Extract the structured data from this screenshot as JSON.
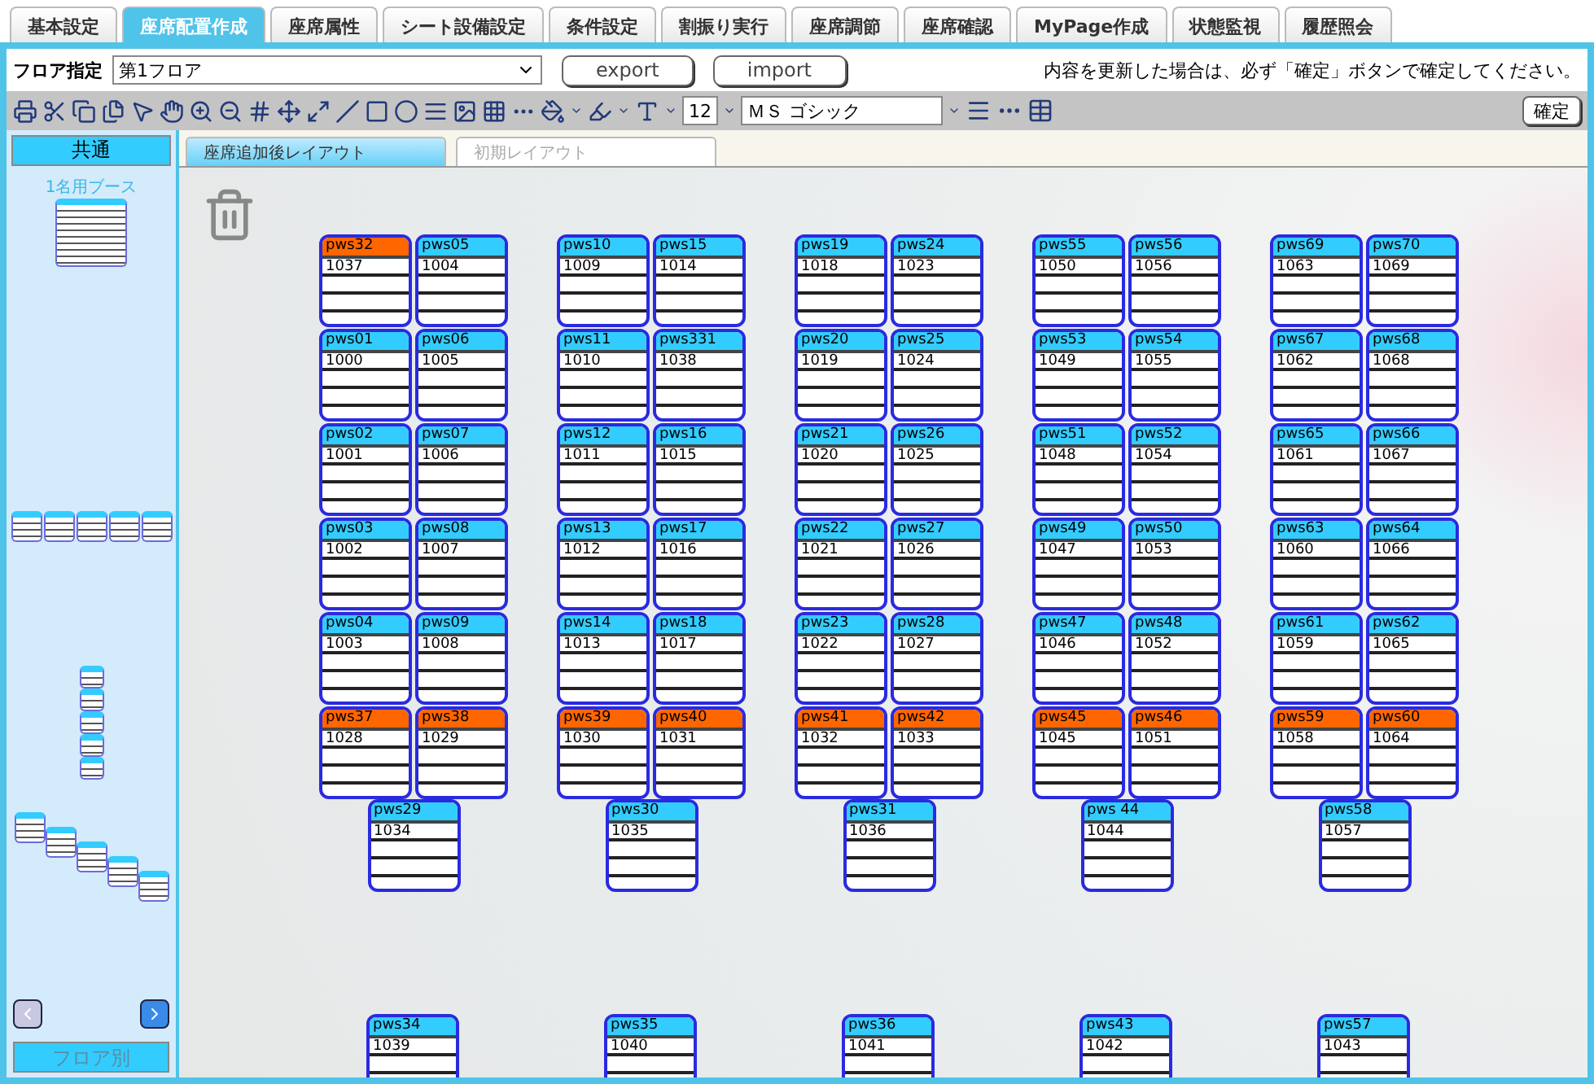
{
  "tabs": [
    {
      "label": "基本設定",
      "selected": false
    },
    {
      "label": "座席配置作成",
      "selected": true
    },
    {
      "label": "座席属性",
      "selected": false
    },
    {
      "label": "シート設備設定",
      "selected": false
    },
    {
      "label": "条件設定",
      "selected": false
    },
    {
      "label": "割振り実行",
      "selected": false
    },
    {
      "label": "座席調節",
      "selected": false
    },
    {
      "label": "座席確認",
      "selected": false
    },
    {
      "label": "MyPage作成",
      "selected": false
    },
    {
      "label": "状態監視",
      "selected": false
    },
    {
      "label": "履歴照会",
      "selected": false
    }
  ],
  "header": {
    "floor_label": "フロア指定",
    "floor_value": "第1フロア",
    "buttons": [
      "export",
      "import"
    ],
    "notice": "内容を更新した場合は、必ず「確定」ボタンで確定してください。"
  },
  "toolbar": {
    "font_size": "12",
    "font_name": "ＭＳ ゴシック",
    "confirm": "確定"
  },
  "sidebar": {
    "header": "共通",
    "booth_label": "1名用ブース",
    "footer": "フロア別"
  },
  "layout_tabs": [
    {
      "label": "座席追加後レイアウト",
      "selected": true
    },
    {
      "label": "初期レイアウト",
      "selected": false
    }
  ],
  "groups": [
    {
      "desks": [
        {
          "name": "pws32",
          "number": "1037",
          "highlighted": true
        },
        {
          "name": "pws05",
          "number": "1004",
          "highlighted": false
        },
        {
          "name": "pws01",
          "number": "1000",
          "highlighted": false
        },
        {
          "name": "pws06",
          "number": "1005",
          "highlighted": false
        },
        {
          "name": "pws02",
          "number": "1001",
          "highlighted": false
        },
        {
          "name": "pws07",
          "number": "1006",
          "highlighted": false
        },
        {
          "name": "pws03",
          "number": "1002",
          "highlighted": false
        },
        {
          "name": "pws08",
          "number": "1007",
          "highlighted": false
        },
        {
          "name": "pws04",
          "number": "1003",
          "highlighted": false
        },
        {
          "name": "pws09",
          "number": "1008",
          "highlighted": false
        },
        {
          "name": "pws37",
          "number": "1028",
          "highlighted": true
        },
        {
          "name": "pws38",
          "number": "1029",
          "highlighted": true
        }
      ],
      "single": {
        "name": "pws29",
        "number": "1034",
        "highlighted": false
      },
      "bottom": {
        "name": "pws34",
        "number": "1039",
        "highlighted": false
      }
    },
    {
      "desks": [
        {
          "name": "pws10",
          "number": "1009",
          "highlighted": false
        },
        {
          "name": "pws15",
          "number": "1014",
          "highlighted": false
        },
        {
          "name": "pws11",
          "number": "1010",
          "highlighted": false
        },
        {
          "name": "pws331",
          "number": "1038",
          "highlighted": false
        },
        {
          "name": "pws12",
          "number": "1011",
          "highlighted": false
        },
        {
          "name": "pws16",
          "number": "1015",
          "highlighted": false
        },
        {
          "name": "pws13",
          "number": "1012",
          "highlighted": false
        },
        {
          "name": "pws17",
          "number": "1016",
          "highlighted": false
        },
        {
          "name": "pws14",
          "number": "1013",
          "highlighted": false
        },
        {
          "name": "pws18",
          "number": "1017",
          "highlighted": false
        },
        {
          "name": "pws39",
          "number": "1030",
          "highlighted": true
        },
        {
          "name": "pws40",
          "number": "1031",
          "highlighted": true
        }
      ],
      "single": {
        "name": "pws30",
        "number": "1035",
        "highlighted": false
      },
      "bottom": {
        "name": "pws35",
        "number": "1040",
        "highlighted": false
      }
    },
    {
      "desks": [
        {
          "name": "pws19",
          "number": "1018",
          "highlighted": false
        },
        {
          "name": "pws24",
          "number": "1023",
          "highlighted": false
        },
        {
          "name": "pws20",
          "number": "1019",
          "highlighted": false
        },
        {
          "name": "pws25",
          "number": "1024",
          "highlighted": false
        },
        {
          "name": "pws21",
          "number": "1020",
          "highlighted": false
        },
        {
          "name": "pws26",
          "number": "1025",
          "highlighted": false
        },
        {
          "name": "pws22",
          "number": "1021",
          "highlighted": false
        },
        {
          "name": "pws27",
          "number": "1026",
          "highlighted": false
        },
        {
          "name": "pws23",
          "number": "1022",
          "highlighted": false
        },
        {
          "name": "pws28",
          "number": "1027",
          "highlighted": false
        },
        {
          "name": "pws41",
          "number": "1032",
          "highlighted": true
        },
        {
          "name": "pws42",
          "number": "1033",
          "highlighted": true
        }
      ],
      "single": {
        "name": "pws31",
        "number": "1036",
        "highlighted": false
      },
      "bottom": {
        "name": "pws36",
        "number": "1041",
        "highlighted": false
      }
    },
    {
      "desks": [
        {
          "name": "pws55",
          "number": "1050",
          "highlighted": false
        },
        {
          "name": "pws56",
          "number": "1056",
          "highlighted": false
        },
        {
          "name": "pws53",
          "number": "1049",
          "highlighted": false
        },
        {
          "name": "pws54",
          "number": "1055",
          "highlighted": false
        },
        {
          "name": "pws51",
          "number": "1048",
          "highlighted": false
        },
        {
          "name": "pws52",
          "number": "1054",
          "highlighted": false
        },
        {
          "name": "pws49",
          "number": "1047",
          "highlighted": false
        },
        {
          "name": "pws50",
          "number": "1053",
          "highlighted": false
        },
        {
          "name": "pws47",
          "number": "1046",
          "highlighted": false
        },
        {
          "name": "pws48",
          "number": "1052",
          "highlighted": false
        },
        {
          "name": "pws45",
          "number": "1045",
          "highlighted": true
        },
        {
          "name": "pws46",
          "number": "1051",
          "highlighted": true
        }
      ],
      "single": {
        "name": "pws 44",
        "number": "1044",
        "highlighted": false
      },
      "bottom": {
        "name": "pws43",
        "number": "1042",
        "highlighted": false
      }
    },
    {
      "desks": [
        {
          "name": "pws69",
          "number": "1063",
          "highlighted": false
        },
        {
          "name": "pws70",
          "number": "1069",
          "highlighted": false
        },
        {
          "name": "pws67",
          "number": "1062",
          "highlighted": false
        },
        {
          "name": "pws68",
          "number": "1068",
          "highlighted": false
        },
        {
          "name": "pws65",
          "number": "1061",
          "highlighted": false
        },
        {
          "name": "pws66",
          "number": "1067",
          "highlighted": false
        },
        {
          "name": "pws63",
          "number": "1060",
          "highlighted": false
        },
        {
          "name": "pws64",
          "number": "1066",
          "highlighted": false
        },
        {
          "name": "pws61",
          "number": "1059",
          "highlighted": false
        },
        {
          "name": "pws62",
          "number": "1065",
          "highlighted": false
        },
        {
          "name": "pws59",
          "number": "1058",
          "highlighted": true
        },
        {
          "name": "pws60",
          "number": "1064",
          "highlighted": true
        }
      ],
      "single": {
        "name": "pws58",
        "number": "1057",
        "highlighted": false
      },
      "bottom": {
        "name": "pws57",
        "number": "1043",
        "highlighted": false
      }
    }
  ]
}
